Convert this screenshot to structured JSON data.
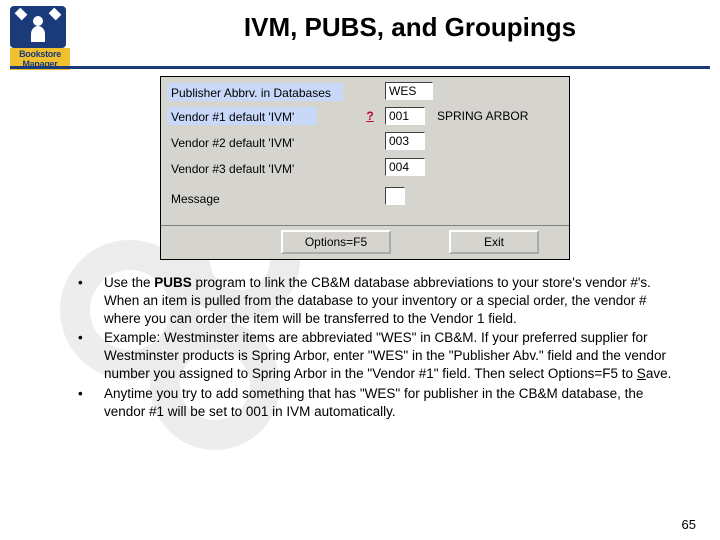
{
  "logo": {
    "line1": "Bookstore",
    "line2": "Manager"
  },
  "title": "IVM, PUBS, and Groupings",
  "dialog": {
    "row1": {
      "label": "Publisher Abbrv. in Databases",
      "value": "WES"
    },
    "row2": {
      "label": "Vendor #1 default 'IVM'",
      "value": "001",
      "vendor_name": "SPRING ARBOR"
    },
    "row3": {
      "label": "Vendor #2 default 'IVM'",
      "value": "003"
    },
    "row4": {
      "label": "Vendor #3 default 'IVM'",
      "value": "004"
    },
    "row5": {
      "label": "Message",
      "value": ""
    },
    "options_button": "Options=F5",
    "exit_button": "Exit",
    "help": "?"
  },
  "bullets": {
    "b1a": "Use the ",
    "b1b": "PUBS",
    "b1c": " program to link the CB&M database abbreviations to your store's vendor #'s. When an item is pulled from the database to your inventory or a special order, the vendor # where you can order the item will be transferred to the Vendor 1 field.",
    "b2": "Example: Westminster items are abbreviated \"WES\" in CB&M. If your preferred supplier for Westminster products is Spring Arbor, enter \"WES\" in the \"Publisher Abv.\" field and the vendor number you assigned to Spring Arbor in the \"Vendor #1\" field. Then select Options=F5 to ",
    "b2s": "S",
    "b2end": "ave.",
    "b3": "Anytime you try to add something that has \"WES\" for publisher in the CB&M database, the vendor #1 will be set to 001 in IVM automatically."
  },
  "page_number": "65"
}
